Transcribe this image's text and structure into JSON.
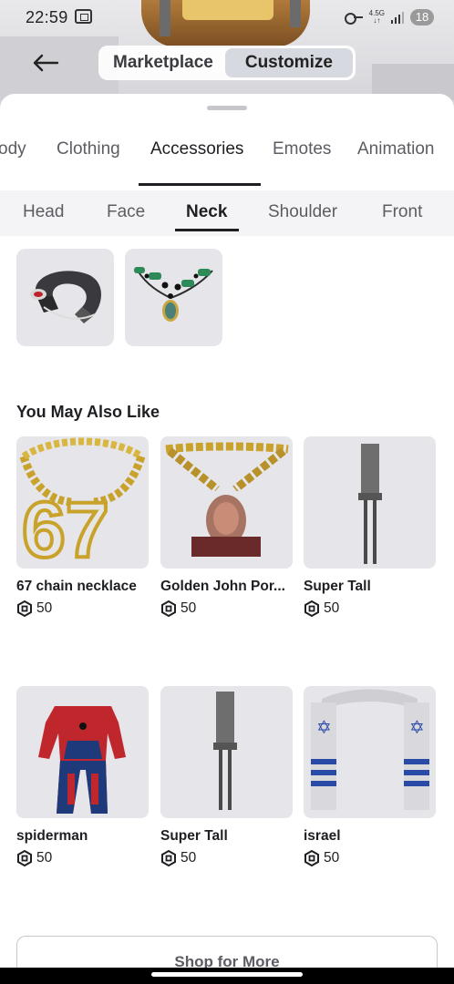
{
  "status_bar": {
    "time": "22:59",
    "network_top": "4.5G",
    "network_bottom": "↓↑",
    "battery": "18"
  },
  "nav": {
    "tabs": [
      {
        "label": "Marketplace",
        "active": false
      },
      {
        "label": "Customize",
        "active": true
      }
    ]
  },
  "categories": [
    {
      "label": "ody",
      "active": false
    },
    {
      "label": "Clothing",
      "active": false
    },
    {
      "label": "Accessories",
      "active": true
    },
    {
      "label": "Emotes",
      "active": false
    },
    {
      "label": "Animation",
      "active": false
    }
  ],
  "subcategories": [
    {
      "label": "Head",
      "active": false
    },
    {
      "label": "Face",
      "active": false
    },
    {
      "label": "Neck",
      "active": true
    },
    {
      "label": "Shoulder",
      "active": false
    },
    {
      "label": "Front",
      "active": false
    }
  ],
  "owned_items": [
    {
      "icon": "neck-pillow-icon"
    },
    {
      "icon": "beaded-necklace-icon"
    }
  ],
  "recommendations": {
    "title": "You May Also Like",
    "items": [
      {
        "name": "67 chain necklace",
        "price": "50",
        "icon": "gold-67-chain-icon"
      },
      {
        "name": "Golden John Por...",
        "price": "50",
        "icon": "gold-chain-portrait-icon"
      },
      {
        "name": "Super Tall",
        "price": "50",
        "icon": "stilt-legs-icon"
      },
      {
        "name": "spiderman",
        "price": "50",
        "icon": "spiderman-suit-icon"
      },
      {
        "name": "Super Tall",
        "price": "50",
        "icon": "stilt-legs-icon"
      },
      {
        "name": "israel",
        "price": "50",
        "icon": "blue-white-scarf-icon"
      }
    ]
  },
  "shop_button": "Shop for More",
  "colors": {
    "card_bg": "#e5e5ea",
    "active_underline": "#1e1f22",
    "text_primary": "#1e1f22",
    "text_secondary": "#5b5d63"
  }
}
